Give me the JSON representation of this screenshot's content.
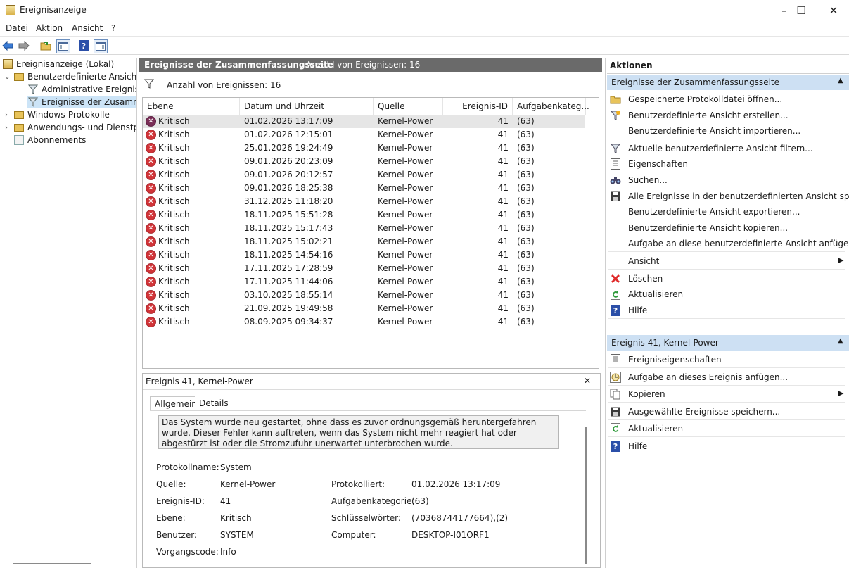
{
  "window": {
    "title": "Ereignisanzeige",
    "minimize": "–",
    "maximize": "☐",
    "close": "✕"
  },
  "menu": [
    "Datei",
    "Aktion",
    "Ansicht",
    "?"
  ],
  "tree": {
    "root": "Ereignisanzeige (Lokal)",
    "custom_views": "Benutzerdefinierte Ansichten",
    "admin_events": "Administrative Ereignisse",
    "summary_events": "Ereignisse der Zusammenfassungsseite",
    "windows_logs": "Windows-Protokolle",
    "app_logs": "Anwendungs- und Dienstprotokolle",
    "subscriptions": "Abonnements"
  },
  "center": {
    "header_title": "Ereignisse der Zusammenfassungsseite",
    "header_count": "Anzahl von Ereignissen: 16",
    "filter_text": "Anzahl von Ereignissen: 16",
    "columns": [
      "Ebene",
      "Datum und Uhrzeit",
      "Quelle",
      "Ereignis-ID",
      "Aufgabenkateg..."
    ],
    "rows": [
      {
        "level": "Kritisch",
        "datetime": "01.02.2026 13:17:09",
        "source": "Kernel-Power",
        "id": "41",
        "task": "(63)"
      },
      {
        "level": "Kritisch",
        "datetime": "01.02.2026 12:15:01",
        "source": "Kernel-Power",
        "id": "41",
        "task": "(63)"
      },
      {
        "level": "Kritisch",
        "datetime": "25.01.2026 19:24:49",
        "source": "Kernel-Power",
        "id": "41",
        "task": "(63)"
      },
      {
        "level": "Kritisch",
        "datetime": "09.01.2026 20:23:09",
        "source": "Kernel-Power",
        "id": "41",
        "task": "(63)"
      },
      {
        "level": "Kritisch",
        "datetime": "09.01.2026 20:12:57",
        "source": "Kernel-Power",
        "id": "41",
        "task": "(63)"
      },
      {
        "level": "Kritisch",
        "datetime": "09.01.2026 18:25:38",
        "source": "Kernel-Power",
        "id": "41",
        "task": "(63)"
      },
      {
        "level": "Kritisch",
        "datetime": "31.12.2025 11:18:20",
        "source": "Kernel-Power",
        "id": "41",
        "task": "(63)"
      },
      {
        "level": "Kritisch",
        "datetime": "18.11.2025 15:51:28",
        "source": "Kernel-Power",
        "id": "41",
        "task": "(63)"
      },
      {
        "level": "Kritisch",
        "datetime": "18.11.2025 15:17:43",
        "source": "Kernel-Power",
        "id": "41",
        "task": "(63)"
      },
      {
        "level": "Kritisch",
        "datetime": "18.11.2025 15:02:21",
        "source": "Kernel-Power",
        "id": "41",
        "task": "(63)"
      },
      {
        "level": "Kritisch",
        "datetime": "18.11.2025 14:54:16",
        "source": "Kernel-Power",
        "id": "41",
        "task": "(63)"
      },
      {
        "level": "Kritisch",
        "datetime": "17.11.2025 17:28:59",
        "source": "Kernel-Power",
        "id": "41",
        "task": "(63)"
      },
      {
        "level": "Kritisch",
        "datetime": "17.11.2025 11:44:06",
        "source": "Kernel-Power",
        "id": "41",
        "task": "(63)"
      },
      {
        "level": "Kritisch",
        "datetime": "03.10.2025 18:55:14",
        "source": "Kernel-Power",
        "id": "41",
        "task": "(63)"
      },
      {
        "level": "Kritisch",
        "datetime": "21.09.2025 19:49:58",
        "source": "Kernel-Power",
        "id": "41",
        "task": "(63)"
      },
      {
        "level": "Kritisch",
        "datetime": "08.09.2025 09:34:37",
        "source": "Kernel-Power",
        "id": "41",
        "task": "(63)"
      }
    ]
  },
  "detail": {
    "title": "Ereignis 41, Kernel-Power",
    "close": "✕",
    "tab_general": "Allgemein",
    "tab_details": "Details",
    "description": "Das System wurde neu gestartet, ohne dass es zuvor ordnungsgemäß heruntergefahren wurde. Dieser Fehler kann auftreten, wenn das System nicht mehr reagiert hat oder abgestürzt ist oder die Stromzufuhr unerwartet unterbrochen wurde.",
    "log_name_label": "Protokollname:",
    "log_name": "System",
    "source_label": "Quelle:",
    "source": "Kernel-Power",
    "logged_label": "Protokolliert:",
    "logged": "01.02.2026 13:17:09",
    "event_id_label": "Ereignis-ID:",
    "event_id": "41",
    "task_label": "Aufgabenkategorie:",
    "task": "(63)",
    "level_label": "Ebene:",
    "level": "Kritisch",
    "keywords_label": "Schlüsselwörter:",
    "keywords": "(70368744177664),(2)",
    "user_label": "Benutzer:",
    "user": "SYSTEM",
    "computer_label": "Computer:",
    "computer": "DESKTOP-I01ORF1",
    "opcode_label": "Vorgangscode:",
    "opcode": "Info"
  },
  "actions": {
    "title": "Aktionen",
    "section1": "Ereignisse der Zusammenfassungsseite",
    "items1": [
      {
        "label": "Gespeicherte Protokolldatei öffnen...",
        "icon": "folder-icon"
      },
      {
        "label": "Benutzerdefinierte Ansicht erstellen...",
        "icon": "filter-star-icon"
      },
      {
        "label": "Benutzerdefinierte Ansicht importieren...",
        "icon": ""
      },
      {
        "label": "Aktuelle benutzerdefinierte Ansicht filtern...",
        "icon": "filter-icon"
      },
      {
        "label": "Eigenschaften",
        "icon": "properties-icon"
      },
      {
        "label": "Suchen...",
        "icon": "binoculars-icon"
      },
      {
        "label": "Alle Ereignisse in der benutzerdefinierten Ansicht spei...",
        "icon": "save-icon"
      },
      {
        "label": "Benutzerdefinierte Ansicht exportieren...",
        "icon": ""
      },
      {
        "label": "Benutzerdefinierte Ansicht kopieren...",
        "icon": ""
      },
      {
        "label": "Aufgabe an diese benutzerdefinierte Ansicht anfügen...",
        "icon": ""
      },
      {
        "label": "Ansicht",
        "icon": ""
      },
      {
        "label": "Löschen",
        "icon": "delete-icon"
      },
      {
        "label": "Aktualisieren",
        "icon": "refresh-icon"
      },
      {
        "label": "Hilfe",
        "icon": "help-icon"
      }
    ],
    "section2": "Ereignis 41, Kernel-Power",
    "items2": [
      {
        "label": "Ereigniseigenschaften",
        "icon": "properties-icon"
      },
      {
        "label": "Aufgabe an dieses Ereignis anfügen...",
        "icon": "task-icon"
      },
      {
        "label": "Kopieren",
        "icon": "copy-icon"
      },
      {
        "label": "Ausgewählte Ereignisse speichern...",
        "icon": "save-icon"
      },
      {
        "label": "Aktualisieren",
        "icon": "refresh-icon"
      },
      {
        "label": "Hilfe",
        "icon": "help-icon"
      }
    ]
  }
}
